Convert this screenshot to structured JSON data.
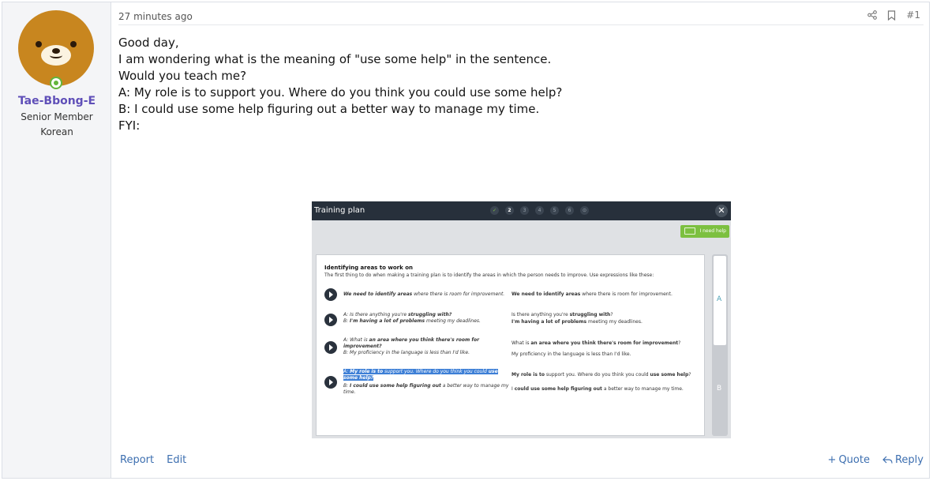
{
  "user": {
    "name": "Tae-Bbong-E",
    "title": "Senior Member",
    "language": "Korean"
  },
  "post": {
    "timestamp": "27 minutes ago",
    "number": "#1",
    "lines": [
      "Good day,",
      "",
      "I am wondering what is the meaning of \"use some help\" in the sentence.",
      "Would you teach me?",
      "",
      "",
      "A: My role is to support you. Where do you think you could use some help?",
      "B: I could use some help figuring out a better way to manage my time.",
      "",
      "FYI:"
    ]
  },
  "embedded_screenshot": {
    "title": "Training plan",
    "steps": [
      "✓",
      "2",
      "3",
      "4",
      "5",
      "6",
      "⊙"
    ],
    "close": "✕",
    "help_button": "I need help",
    "panel_title": "Identifying areas to work on",
    "panel_intro": "The first thing to do when making a training plan is to identify the areas in which the person needs to improve. Use expressions like these:",
    "side_a": "A",
    "side_b": "B",
    "rows": [
      {
        "left_a_bold": "We need to identify areas",
        "left_a_rest": " where there is room for improvement.",
        "right_a_bold": "We need to identify areas",
        "right_a_rest": " where there is room for improvement."
      },
      {
        "left_a_pre": "A: Is there anything you're ",
        "left_a_bold": "struggling with?",
        "left_b_pre": "B: ",
        "left_b_bold": "I'm having a lot of problems",
        "left_b_rest": " meeting my deadlines.",
        "right_a_pre": "Is there anything you're ",
        "right_a_bold": "struggling with",
        "right_a_rest": "?",
        "right_b_bold": "I'm having a lot of problems",
        "right_b_rest": " meeting my deadlines."
      },
      {
        "left_a_pre": "A: What is ",
        "left_a_bold": "an area where you think there's room for improvement?",
        "left_b": "B: My proficiency in the language is less than I'd like.",
        "right_a_pre": "What is ",
        "right_a_bold": "an area where you think there's room for improvement",
        "right_a_rest": "?",
        "right_b": "My proficiency in the language is less than I'd like."
      },
      {
        "left_a_pre": "A: ",
        "left_a_bold": "My role is to",
        "left_a_mid": " support you. Where do you think you could ",
        "left_a_bold2": "use some help?",
        "left_b_pre": "B: ",
        "left_b_bold": "I could use some help figuring out",
        "left_b_rest": " a better way to manage my time.",
        "right_a_bold": "My role is to",
        "right_a_mid": " support you. Where do you think you could ",
        "right_a_bold2": "use some help",
        "right_a_rest": "?",
        "right_b_pre": "I ",
        "right_b_bold": "could use some help figuring out",
        "right_b_rest": " a better way to manage my time."
      }
    ]
  },
  "footer": {
    "report": "Report",
    "edit": "Edit",
    "quote": "Quote",
    "reply": "Reply"
  },
  "colors": {
    "username": "#5f4fb8",
    "link": "#3d6fb0",
    "online": "#63b53c",
    "help_button": "#7cc040"
  }
}
